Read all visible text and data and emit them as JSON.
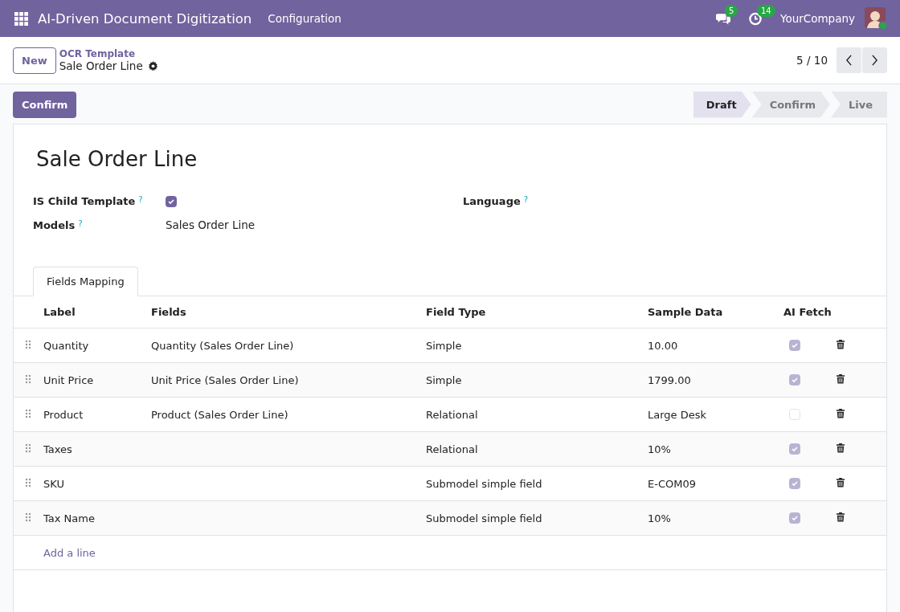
{
  "navbar": {
    "app_title": "AI-Driven Document Digitization",
    "menu": [
      "Configuration"
    ],
    "messages_badge": "5",
    "activities_badge": "14",
    "company": "YourCompany"
  },
  "control_panel": {
    "new_button": "New",
    "breadcrumb": "OCR Template",
    "record": "Sale Order Line",
    "pager": "5 / 10"
  },
  "action_button": "Confirm",
  "stages": [
    {
      "label": "Draft",
      "selected": true
    },
    {
      "label": "Confirm",
      "selected": false
    },
    {
      "label": "Live",
      "selected": false
    }
  ],
  "form": {
    "title": "Sale Order Line",
    "is_child_label": "IS Child Template",
    "is_child_help": "?",
    "is_child_checked": true,
    "language_label": "Language",
    "language_help": "?",
    "models_label": "Models",
    "models_help": "?",
    "models_value": "Sales Order Line"
  },
  "tabs": [
    {
      "label": "Fields Mapping",
      "selected": true
    }
  ],
  "table": {
    "columns": [
      "Label",
      "Fields",
      "Field Type",
      "Sample Data",
      "AI Fetch"
    ],
    "rows": [
      {
        "label": "Quantity",
        "fields": "Quantity (Sales Order Line)",
        "field_type": "Simple",
        "sample": "10.00",
        "ai_fetch": true
      },
      {
        "label": "Unit Price",
        "fields": "Unit Price (Sales Order Line)",
        "field_type": "Simple",
        "sample": "1799.00",
        "ai_fetch": true
      },
      {
        "label": "Product",
        "fields": "Product (Sales Order Line)",
        "field_type": "Relational",
        "sample": "Large Desk",
        "ai_fetch": false
      },
      {
        "label": "Taxes",
        "field_type": "Relational",
        "sample": "10%",
        "ai_fetch": true
      },
      {
        "label": "SKU",
        "field_type": "Submodel simple field",
        "sample": "E-COM09",
        "ai_fetch": true
      },
      {
        "label": "Tax Name",
        "field_type": "Submodel simple field",
        "sample": "10%",
        "ai_fetch": true
      }
    ],
    "add_line": "Add a line"
  }
}
